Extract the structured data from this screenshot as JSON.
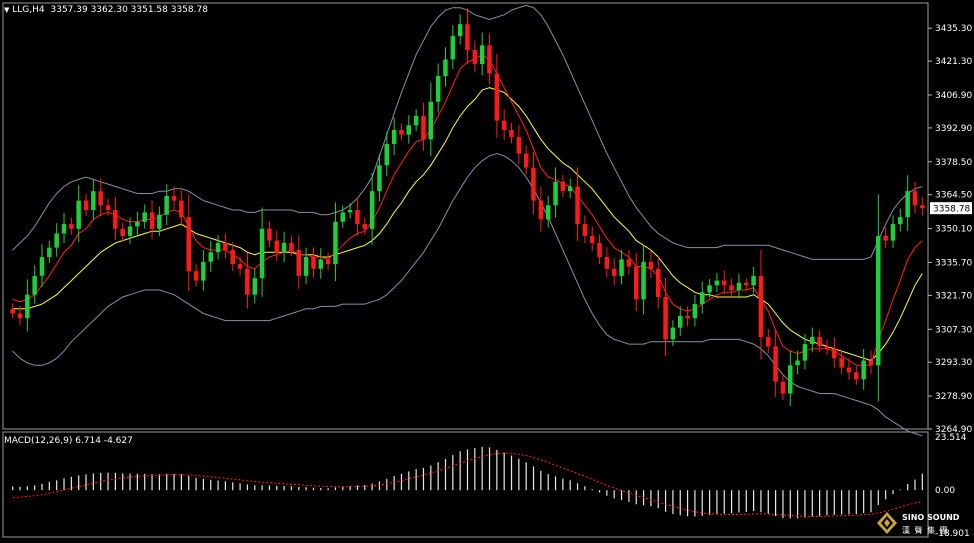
{
  "header": {
    "symbol": "LLG,H4",
    "ohlc": "3357.39 3362.30 3351.58 3358.78"
  },
  "macd": {
    "label": "MACD(12,26,9) 6.714 -4.627"
  },
  "logo": {
    "brand": "SINO SOUND",
    "sub": "漢 聲 集 團"
  },
  "colors": {
    "bull": "#1fcf3a",
    "bear": "#ff1a1a",
    "ma_fast": "#ff2020",
    "ma_slow": "#ffff33",
    "band": "#8a8fa0",
    "signal": "#ff2020"
  },
  "chart_data": [
    {
      "type": "candlestick",
      "title": "LLG,H4",
      "ylim": [
        3264.9,
        3446.0
      ],
      "y_ticks": [
        3435.3,
        3421.3,
        3406.9,
        3392.9,
        3378.5,
        3364.5,
        3350.1,
        3335.7,
        3321.7,
        3307.3,
        3293.3,
        3278.9,
        3264.9
      ],
      "current_price": 3358.78,
      "closes": [
        3314,
        3312,
        3322,
        3330,
        3338,
        3342,
        3348,
        3352,
        3350,
        3362,
        3358,
        3366,
        3360,
        3358,
        3350,
        3347,
        3351,
        3353,
        3357,
        3350,
        3356,
        3364,
        3362,
        3355,
        3332,
        3328,
        3336,
        3340,
        3344,
        3341,
        3335,
        3333,
        3322,
        3329,
        3350,
        3345,
        3340,
        3344,
        3341,
        3330,
        3338,
        3333,
        3337,
        3335,
        3353,
        3357,
        3358,
        3352,
        3350,
        3366,
        3377,
        3386,
        3392,
        3390,
        3394,
        3398,
        3388,
        3404,
        3415,
        3422,
        3432,
        3437,
        3426,
        3420,
        3428,
        3416,
        3396,
        3392,
        3389,
        3382,
        3376,
        3362,
        3354,
        3360,
        3370,
        3366,
        3368,
        3352,
        3347,
        3344,
        3338,
        3333,
        3330,
        3337,
        3334,
        3320,
        3336,
        3333,
        3321,
        3303,
        3308,
        3313,
        3312,
        3318,
        3323,
        3326,
        3328,
        3326,
        3324,
        3327,
        3326,
        3330,
        3304,
        3300,
        3285,
        3280,
        3292,
        3294,
        3301,
        3304,
        3300,
        3299,
        3295,
        3291,
        3289,
        3286,
        3294,
        3292,
        3347,
        3345,
        3352,
        3355,
        3366,
        3360,
        3358.78
      ],
      "ma_fast": [
        3320,
        3319,
        3320,
        3322,
        3326,
        3330,
        3335,
        3340,
        3343,
        3348,
        3350,
        3354,
        3356,
        3357,
        3356,
        3354,
        3353,
        3353,
        3354,
        3354,
        3355,
        3357,
        3358,
        3357,
        3351,
        3345,
        3342,
        3341,
        3341,
        3341,
        3339,
        3337,
        3334,
        3333,
        3336,
        3338,
        3339,
        3340,
        3341,
        3339,
        3339,
        3338,
        3338,
        3337,
        3340,
        3343,
        3346,
        3348,
        3349,
        3353,
        3359,
        3366,
        3373,
        3378,
        3383,
        3387,
        3388,
        3392,
        3398,
        3404,
        3411,
        3418,
        3421,
        3422,
        3424,
        3422,
        3416,
        3410,
        3404,
        3398,
        3392,
        3384,
        3376,
        3372,
        3371,
        3369,
        3368,
        3364,
        3360,
        3356,
        3351,
        3346,
        3342,
        3340,
        3338,
        3334,
        3334,
        3333,
        3330,
        3323,
        3318,
        3316,
        3315,
        3316,
        3318,
        3320,
        3322,
        3323,
        3323,
        3324,
        3324,
        3325,
        3320,
        3315,
        3307,
        3300,
        3298,
        3297,
        3298,
        3299,
        3299,
        3299,
        3298,
        3296,
        3294,
        3292,
        3292,
        3292,
        3303,
        3311,
        3320,
        3328,
        3337,
        3342,
        3345
      ],
      "ma_slow": [
        3316,
        3316,
        3316,
        3317,
        3318,
        3320,
        3322,
        3325,
        3328,
        3331,
        3334,
        3337,
        3340,
        3342,
        3344,
        3345,
        3346,
        3347,
        3348,
        3349,
        3349,
        3350,
        3351,
        3352,
        3350,
        3348,
        3347,
        3346,
        3345,
        3344,
        3343,
        3342,
        3340,
        3339,
        3340,
        3340,
        3340,
        3340,
        3340,
        3339,
        3339,
        3339,
        3338,
        3338,
        3339,
        3340,
        3341,
        3342,
        3343,
        3345,
        3348,
        3352,
        3357,
        3361,
        3366,
        3370,
        3373,
        3377,
        3382,
        3387,
        3393,
        3398,
        3402,
        3405,
        3409,
        3410,
        3409,
        3408,
        3405,
        3402,
        3398,
        3393,
        3388,
        3384,
        3381,
        3378,
        3376,
        3373,
        3370,
        3367,
        3363,
        3359,
        3355,
        3352,
        3349,
        3345,
        3343,
        3341,
        3338,
        3334,
        3330,
        3327,
        3325,
        3323,
        3322,
        3322,
        3321,
        3321,
        3321,
        3321,
        3321,
        3322,
        3320,
        3318,
        3314,
        3310,
        3307,
        3305,
        3303,
        3302,
        3301,
        3300,
        3299,
        3298,
        3297,
        3296,
        3295,
        3294,
        3297,
        3301,
        3306,
        3312,
        3319,
        3326,
        3331
      ],
      "band_upper": [
        3341,
        3344,
        3347,
        3351,
        3356,
        3361,
        3365,
        3368,
        3370,
        3371,
        3372,
        3371,
        3370,
        3369,
        3368,
        3367,
        3366,
        3365,
        3365,
        3365,
        3366,
        3366,
        3367,
        3367,
        3366,
        3364,
        3362,
        3361,
        3360,
        3359,
        3358,
        3358,
        3357,
        3357,
        3358,
        3358,
        3358,
        3358,
        3358,
        3357,
        3357,
        3357,
        3356,
        3356,
        3357,
        3358,
        3360,
        3363,
        3367,
        3372,
        3381,
        3390,
        3399,
        3408,
        3416,
        3424,
        3430,
        3436,
        3440,
        3443,
        3444,
        3444,
        3443,
        3441,
        3440,
        3439,
        3440,
        3441,
        3443,
        3444,
        3445,
        3444,
        3441,
        3436,
        3430,
        3424,
        3417,
        3410,
        3403,
        3396,
        3389,
        3382,
        3376,
        3370,
        3364,
        3359,
        3355,
        3351,
        3348,
        3346,
        3344,
        3343,
        3342,
        3342,
        3342,
        3342,
        3342,
        3343,
        3343,
        3343,
        3343,
        3343,
        3343,
        3343,
        3342,
        3341,
        3340,
        3339,
        3338,
        3337,
        3337,
        3337,
        3337,
        3337,
        3337,
        3337,
        3337,
        3338,
        3345,
        3352,
        3358,
        3362,
        3365,
        3367,
        3368
      ],
      "band_lower": [
        3298,
        3295,
        3293,
        3292,
        3292,
        3293,
        3295,
        3298,
        3302,
        3305,
        3308,
        3311,
        3314,
        3317,
        3319,
        3321,
        3322,
        3323,
        3324,
        3324,
        3324,
        3323,
        3322,
        3320,
        3318,
        3316,
        3314,
        3313,
        3312,
        3311,
        3311,
        3311,
        3311,
        3311,
        3311,
        3311,
        3312,
        3313,
        3314,
        3315,
        3316,
        3316,
        3317,
        3317,
        3317,
        3318,
        3318,
        3318,
        3318,
        3319,
        3320,
        3322,
        3325,
        3328,
        3332,
        3336,
        3340,
        3345,
        3350,
        3356,
        3362,
        3367,
        3372,
        3376,
        3379,
        3381,
        3382,
        3381,
        3379,
        3376,
        3372,
        3367,
        3361,
        3355,
        3348,
        3341,
        3334,
        3327,
        3320,
        3314,
        3309,
        3305,
        3303,
        3302,
        3301,
        3301,
        3301,
        3302,
        3302,
        3302,
        3302,
        3302,
        3302,
        3302,
        3302,
        3303,
        3303,
        3303,
        3303,
        3303,
        3302,
        3301,
        3299,
        3296,
        3292,
        3288,
        3285,
        3283,
        3282,
        3281,
        3280,
        3280,
        3280,
        3279,
        3278,
        3277,
        3276,
        3275,
        3273,
        3270,
        3268,
        3266,
        3264,
        3263,
        3262
      ]
    },
    {
      "type": "bar",
      "title": "MACD(12,26,9) 6.714 -4.627",
      "ylim": [
        -18.901,
        23.514
      ],
      "y_ticks": [
        23.514,
        0.0,
        -18.901
      ],
      "macd": [
        1.5,
        1.4,
        1.6,
        2.0,
        2.6,
        3.3,
        4.0,
        4.8,
        5.4,
        6.0,
        6.4,
        6.8,
        7.0,
        7.1,
        7.0,
        6.8,
        6.7,
        6.6,
        6.6,
        6.5,
        6.5,
        6.6,
        6.6,
        6.4,
        5.8,
        5.1,
        4.6,
        4.2,
        3.9,
        3.6,
        3.2,
        2.8,
        2.3,
        2.0,
        2.0,
        1.9,
        1.8,
        1.7,
        1.6,
        1.3,
        1.2,
        1.0,
        0.9,
        0.8,
        1.1,
        1.4,
        1.7,
        1.9,
        2.0,
        2.7,
        3.6,
        4.6,
        5.7,
        6.6,
        7.6,
        8.5,
        9.0,
        10.0,
        11.3,
        12.6,
        14.2,
        15.7,
        16.5,
        17.0,
        17.5,
        17.3,
        16.3,
        15.2,
        14.0,
        12.7,
        11.3,
        9.6,
        7.8,
        6.5,
        5.6,
        4.7,
        4.0,
        2.8,
        1.6,
        0.4,
        -0.9,
        -2.2,
        -3.3,
        -4.0,
        -4.7,
        -5.7,
        -6.1,
        -6.5,
        -7.3,
        -8.7,
        -9.6,
        -10.1,
        -10.5,
        -10.6,
        -10.4,
        -10.1,
        -9.8,
        -9.5,
        -9.3,
        -9.0,
        -8.8,
        -8.4,
        -8.9,
        -9.5,
        -10.4,
        -11.3,
        -11.4,
        -11.4,
        -11.1,
        -10.8,
        -10.5,
        -10.2,
        -10.0,
        -9.8,
        -9.7,
        -9.6,
        -9.2,
        -8.9,
        -6.0,
        -3.7,
        -1.6,
        0.3,
        2.5,
        4.3,
        6.714
      ],
      "signal": [
        -3.0,
        -2.8,
        -2.5,
        -2.2,
        -1.8,
        -1.2,
        -0.6,
        0.1,
        0.8,
        1.5,
        2.2,
        2.9,
        3.5,
        4.1,
        4.6,
        5.0,
        5.3,
        5.6,
        5.8,
        6.0,
        6.1,
        6.2,
        6.3,
        6.3,
        6.2,
        6.0,
        5.7,
        5.4,
        5.1,
        4.8,
        4.5,
        4.2,
        3.8,
        3.5,
        3.2,
        3.0,
        2.8,
        2.6,
        2.4,
        2.2,
        2.0,
        1.8,
        1.6,
        1.5,
        1.4,
        1.4,
        1.4,
        1.5,
        1.6,
        1.8,
        2.1,
        2.6,
        3.2,
        3.9,
        4.6,
        5.4,
        6.2,
        7.0,
        7.8,
        8.8,
        9.8,
        10.9,
        11.9,
        12.8,
        13.7,
        14.4,
        14.8,
        15.0,
        14.9,
        14.5,
        14.0,
        13.2,
        12.3,
        11.2,
        10.1,
        9.0,
        7.9,
        6.8,
        5.6,
        4.4,
        3.2,
        2.0,
        0.9,
        -0.1,
        -1.1,
        -2.1,
        -3.0,
        -3.9,
        -4.8,
        -5.7,
        -6.6,
        -7.4,
        -8.1,
        -8.7,
        -9.2,
        -9.5,
        -9.7,
        -9.8,
        -9.8,
        -9.8,
        -9.7,
        -9.6,
        -9.6,
        -9.6,
        -9.8,
        -10.0,
        -10.2,
        -10.4,
        -10.5,
        -10.6,
        -10.6,
        -10.5,
        -10.4,
        -10.3,
        -10.2,
        -10.0,
        -9.9,
        -9.7,
        -9.2,
        -8.5,
        -7.7,
        -6.8,
        -5.9,
        -5.2,
        -4.627
      ]
    }
  ]
}
